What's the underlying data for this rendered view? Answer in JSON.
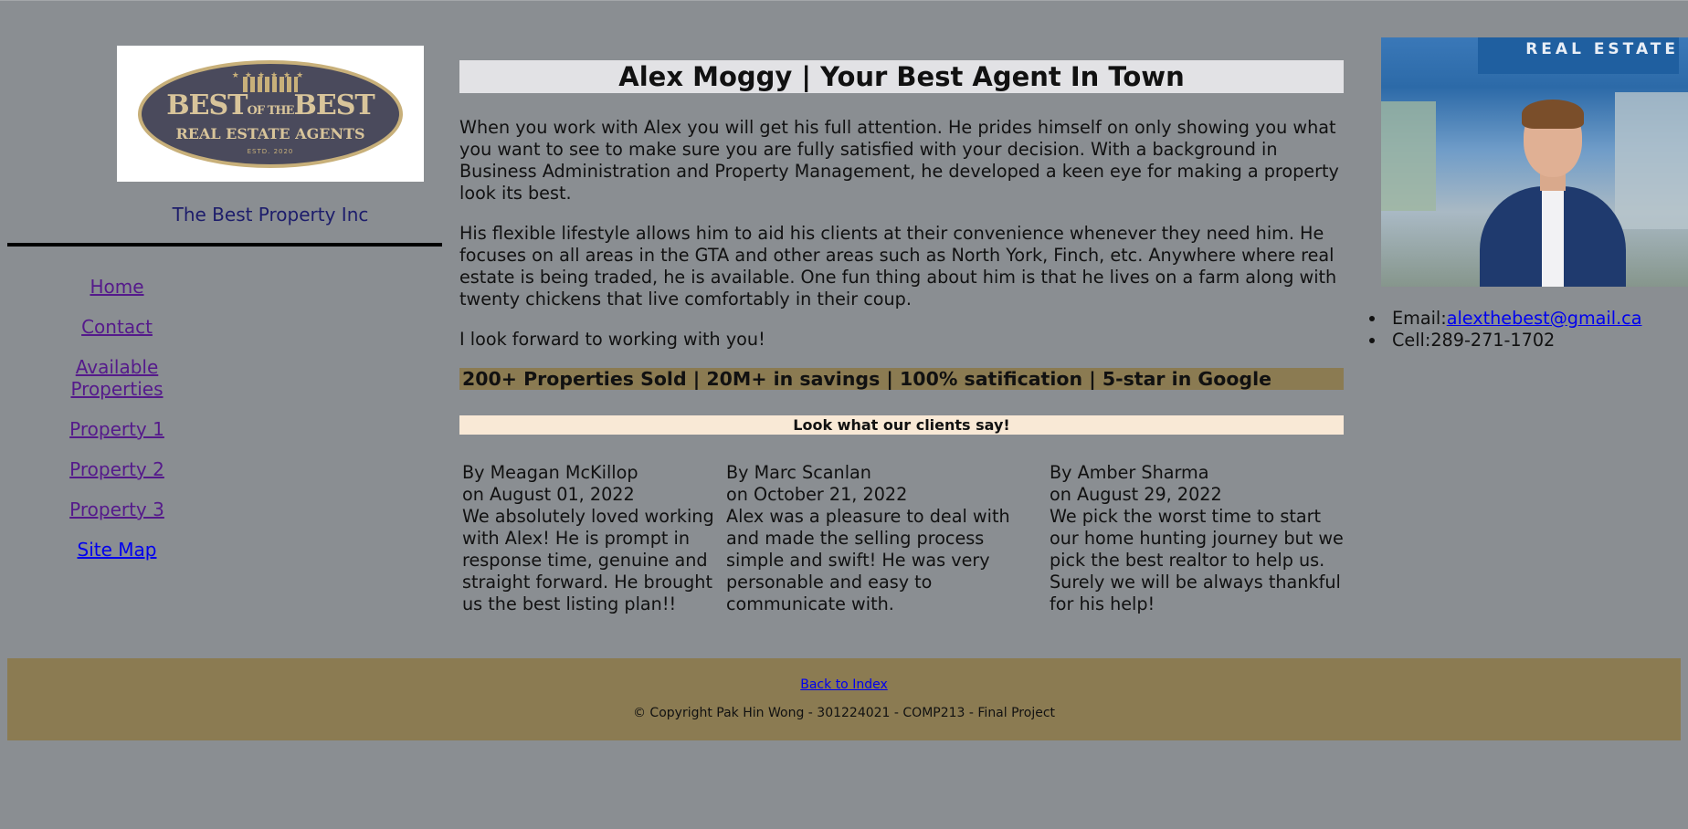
{
  "brand": {
    "logo_line1": "BEST",
    "logo_of_the": "OF THE",
    "logo_line1b": "BEST",
    "logo_line2": "REAL ESTATE AGENTS",
    "logo_est": "ESTD. 2020",
    "company": "The Best Property Inc"
  },
  "nav": {
    "items": [
      {
        "label": "Home"
      },
      {
        "label": "Contact"
      },
      {
        "label": "Available Properties"
      },
      {
        "label": "Property 1"
      },
      {
        "label": "Property 2"
      },
      {
        "label": "Property 3"
      },
      {
        "label": "Site Map"
      }
    ]
  },
  "main": {
    "title": "Alex Moggy | Your Best Agent In Town",
    "paragraphs": [
      "When you work with Alex you will get his full attention. He prides himself on only showing you what you want to see to make sure you are fully satisfied with your decision. With a background in Business Administration and Property Management, he developed a keen eye for making a property look its best.",
      "His flexible lifestyle allows him to aid his clients at their convenience whenever they need him. He focuses on all areas in the GTA and other areas such as North York, Finch, etc. Anywhere where real estate is being traded, he is available. One fun thing about him is that he lives on a farm along with twenty chickens that live comfortably in their coup.",
      "I look forward to working with you!"
    ],
    "stats": "200+ Properties Sold | 20M+ in savings | 100% satification | 5-star in Google",
    "clients_heading": "Look what our clients say!",
    "reviews": [
      {
        "author": "By Meagan McKillop",
        "date": "on August 01, 2022",
        "text": "We absolutely loved working with Alex! He is prompt in response time, genuine and straight forward. He brought us the best listing plan!!"
      },
      {
        "author": "By Marc Scanlan",
        "date": "on October 21, 2022",
        "text": "Alex was a pleasure to deal with and made the selling process simple and swift! He was very personable and easy to communicate with."
      },
      {
        "author": "By Amber Sharma",
        "date": "on August 29, 2022",
        "text": "We pick the worst time to start our home hunting journey but we pick the best realtor to help us. Surely we will be always thankful for his help!"
      }
    ]
  },
  "sidebar": {
    "photo_sign": "REAL ESTATE",
    "email_label": "Email:",
    "email": "alexthebest@gmail.ca",
    "cell": "Cell:289-271-1702"
  },
  "footer": {
    "back_link": "Back to Index",
    "copyright": "© Copyright Pak Hin Wong - 301224021 - COMP213 - Final Project"
  },
  "colors": {
    "page_bg": "#8a8e92",
    "title_bg": "#e2e2e5",
    "stats_bg": "#8b7b52",
    "clients_bar_bg": "#f9e9d6",
    "visited_link": "#551a8b",
    "link": "#0000ee"
  }
}
